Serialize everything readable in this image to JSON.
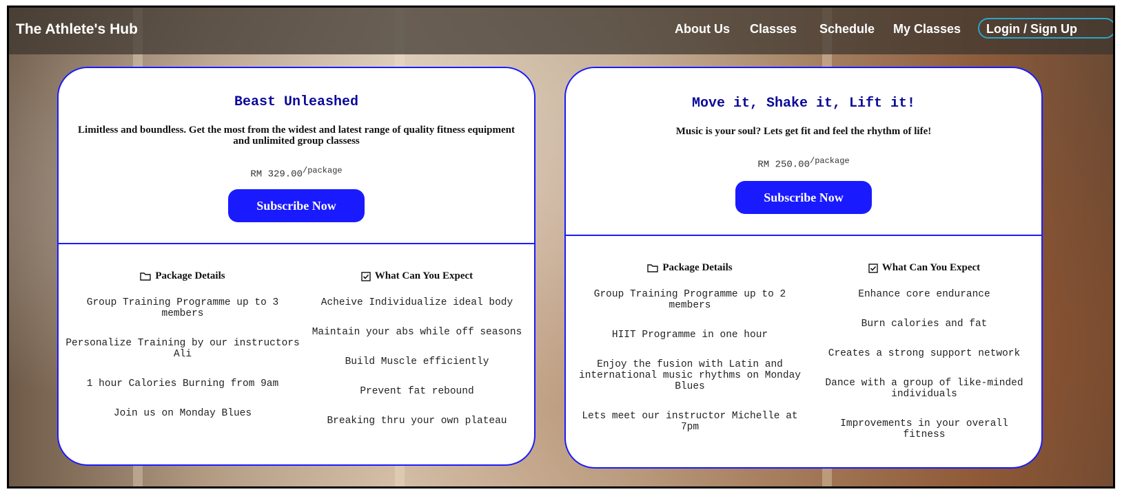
{
  "nav": {
    "brand": "The Athlete's Hub",
    "links": [
      "About Us",
      "Classes",
      "Schedule",
      "My Classes"
    ],
    "login": "Login / Sign Up"
  },
  "cards": [
    {
      "title": "Beast Unleashed",
      "description": "Limitless and boundless. Get the most from the widest and latest range of quality fitness equipment and unlimited group classess",
      "price": "RM 329.00",
      "price_unit": "/package",
      "button": "Subscribe Now",
      "details_heading": "Package Details",
      "details": [
        "Group Training Programme up to 3 members",
        "Personalize Training by our instructors Ali",
        "1 hour Calories Burning from 9am",
        "Join us on Monday Blues"
      ],
      "expect_heading": "What Can You Expect",
      "expect": [
        "Acheive Individualize ideal body",
        "Maintain your abs while off seasons",
        "Build Muscle efficiently",
        "Prevent fat rebound",
        "Breaking thru your own plateau"
      ]
    },
    {
      "title": "Move it, Shake it, Lift it!",
      "description": "Music is your soul? Lets get fit and feel the rhythm of life!",
      "price": "RM 250.00",
      "price_unit": "/package",
      "button": "Subscribe Now",
      "details_heading": "Package Details",
      "details": [
        "Group Training Programme up to 2 members",
        "HIIT Programme in one hour",
        "Enjoy the fusion with Latin and international music rhythms on Monday Blues",
        "Lets meet our instructor Michelle at 7pm"
      ],
      "expect_heading": "What Can You Expect",
      "expect": [
        "Enhance core endurance",
        "Burn calories and fat",
        "Creates a strong support network",
        "Dance with a group of like-minded individuals",
        "Improvements in your overall fitness"
      ]
    }
  ],
  "colors": {
    "accent": "#1a1aff",
    "title": "#0a0a9a",
    "login_border": "#2aa6c9"
  }
}
